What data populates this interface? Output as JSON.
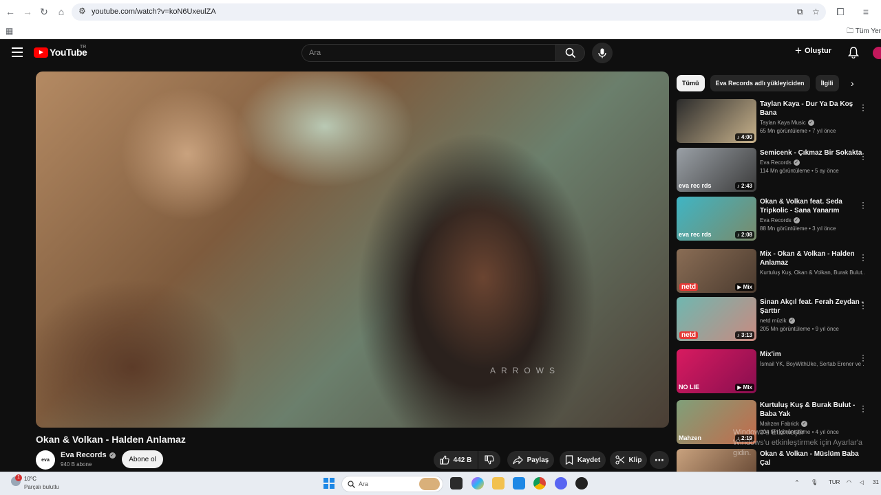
{
  "browser": {
    "url": "youtube.com/watch?v=koN6UxeulZA",
    "bookmark_folder": "Tüm Yer"
  },
  "youtube": {
    "logo_text": "YouTube",
    "country": "TR",
    "search_placeholder": "Ara",
    "create_label": "Oluştur"
  },
  "video": {
    "title": "Okan & Volkan - Halden Anlamaz",
    "channel": "Eva Records",
    "channel_avatar_text": "eva",
    "subscribers": "940 B abone",
    "subscribe_label": "Abone ol",
    "likes": "442 B",
    "share_label": "Paylaş",
    "save_label": "Kaydet",
    "clip_label": "Klip",
    "watermark": "ARROWS"
  },
  "chips": [
    "Tümü",
    "Eva Records adlı yükleyiciden",
    "İlgili"
  ],
  "recommendations": [
    {
      "title": "Taylan Kaya - Dur Ya Da Koş Bana",
      "channel": "Taylan Kaya Music",
      "verified": true,
      "meta": "65 Mn görüntüleme • 7 yıl önce",
      "duration": "4:00",
      "colors": [
        "#2b2b2b",
        "#c9b38c"
      ],
      "tag": ""
    },
    {
      "title": "Semicenk - Çıkmaz Bir Sokakta",
      "channel": "Eva Records",
      "verified": true,
      "meta": "114 Mn görüntüleme • 5 ay önce",
      "duration": "2:43",
      "colors": [
        "#9aa0a6",
        "#3b3b3b"
      ],
      "tag": "eva rec rds"
    },
    {
      "title": "Okan & Volkan feat. Seda Tripkolic - Sana Yanarım",
      "channel": "Eva Records",
      "verified": true,
      "meta": "88 Mn görüntüleme • 3 yıl önce",
      "duration": "2:08",
      "colors": [
        "#3fb5c4",
        "#7a8a6a"
      ],
      "tag": "eva rec rds"
    },
    {
      "title": "Mix - Okan & Volkan - Halden Anlamaz",
      "channel": "Kurtuluş Kuş, Okan & Volkan, Burak Bulut...",
      "verified": false,
      "meta": "",
      "duration": "Mix",
      "colors": [
        "#8a6d55",
        "#4a3a2e"
      ],
      "tag": "netd"
    },
    {
      "title": "Sinan Akçıl feat. Ferah Zeydan - Şarttır",
      "channel": "netd müzik",
      "verified": true,
      "meta": "205 Mn görüntüleme • 9 yıl önce",
      "duration": "3:13",
      "colors": [
        "#6fb7b0",
        "#c98a80"
      ],
      "tag": "netd"
    },
    {
      "title": "Mix'im",
      "channel": "İsmail YK, BoyWithUke, Sertab Erener ve ...",
      "verified": false,
      "meta": "",
      "duration": "Mix",
      "colors": [
        "#d81b60",
        "#880e4f"
      ],
      "tag": "NO LIE"
    },
    {
      "title": "Kurtuluş Kuş & Burak Bulut - Baba Yak",
      "channel": "Mahzen Fabrick",
      "verified": true,
      "meta": "204 Mn görüntüleme • 4 yıl önce",
      "duration": "2:19",
      "colors": [
        "#7fa07a",
        "#c46a4a"
      ],
      "tag": "Mahzen"
    },
    {
      "title": "Okan & Volkan - Müslüm Baba Çal",
      "channel": "",
      "verified": false,
      "meta": "",
      "duration": "",
      "colors": [
        "#c9a27e",
        "#5a3d2b"
      ],
      "tag": ""
    }
  ],
  "overlay": {
    "line1": "Windows'u Etkinleştir",
    "line2": "Windows'u etkinleştirmek için Ayarlar'a gidin."
  },
  "taskbar": {
    "weather_badge": "1",
    "temperature": "10°C",
    "condition": "Parçalı bulutlu",
    "search_placeholder": "Ara",
    "language": "TUR",
    "time": "31"
  }
}
